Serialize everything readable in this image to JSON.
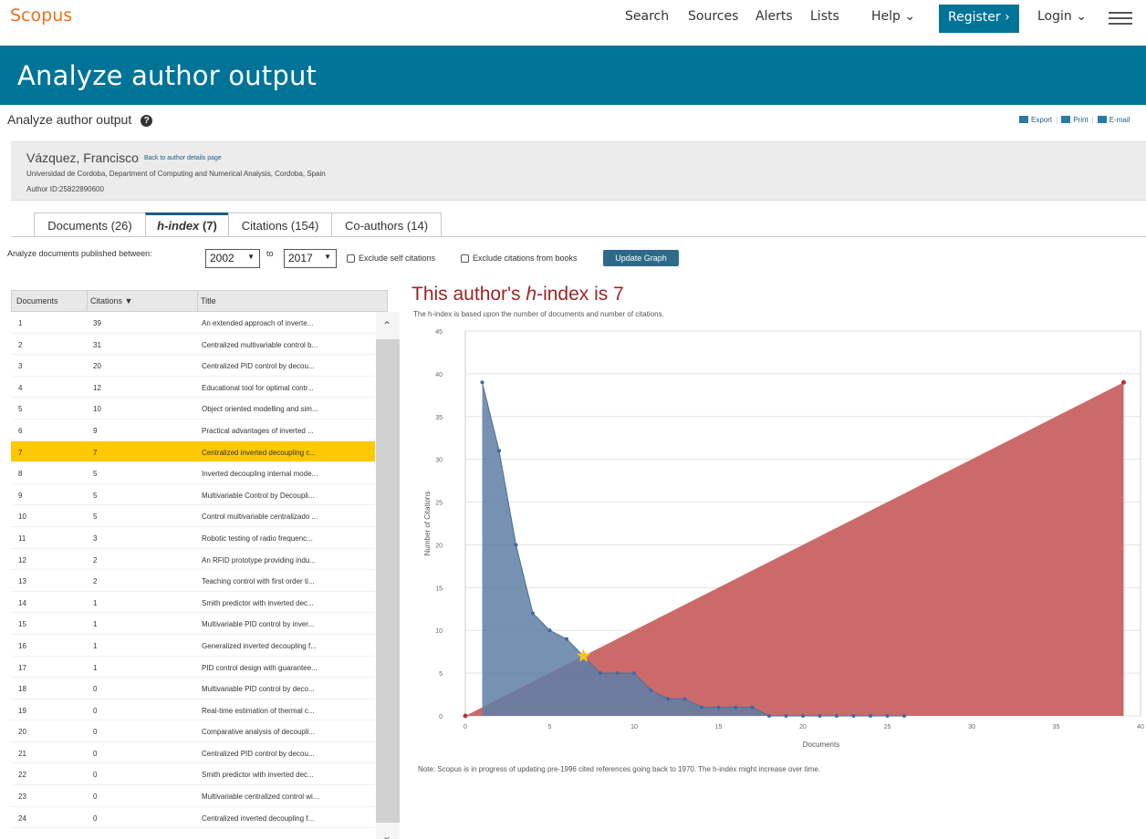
{
  "header": {
    "logo": "Scopus",
    "nav": [
      "Search",
      "Sources",
      "Alerts",
      "Lists"
    ],
    "help": "Help ⌄",
    "register": "Register ›",
    "login": "Login ⌄"
  },
  "banner": {
    "title": "Analyze author output"
  },
  "subheader": {
    "title": "Analyze author output",
    "export": "Export",
    "print": "Print",
    "email": "E-mail"
  },
  "author": {
    "name": "Vázquez, Francisco",
    "back_link": "Back to author details page",
    "affiliation": "Universidad de Cordoba, Department of Computing and Numerical Analysis, Cordoba, Spain",
    "author_id": "Author ID:25822890600"
  },
  "tabs": [
    {
      "prefix": "Documents",
      "value": "(26)"
    },
    {
      "prefix": "h-index",
      "value": "(7)"
    },
    {
      "prefix": "Citations",
      "value": "(154)"
    },
    {
      "prefix": "Co-authors",
      "value": "(14)"
    }
  ],
  "filter": {
    "label": "Analyze documents published between:",
    "from": "2002",
    "to_label": "to",
    "to": "2017",
    "exclude_self": "Exclude self citations",
    "exclude_books": "Exclude citations from books",
    "update_button": "Update Graph"
  },
  "table": {
    "headers": {
      "documents": "Documents",
      "citations": "Citations",
      "title": "Title"
    },
    "rows": [
      {
        "doc": "1",
        "cit": "39",
        "title": "An extended approach of inverte..."
      },
      {
        "doc": "2",
        "cit": "31",
        "title": "Centralized multivariable control b..."
      },
      {
        "doc": "3",
        "cit": "20",
        "title": "Centralized PID control by decou..."
      },
      {
        "doc": "4",
        "cit": "12",
        "title": "Educational tool for optimal contr..."
      },
      {
        "doc": "5",
        "cit": "10",
        "title": "Object oriented modelling and sim..."
      },
      {
        "doc": "6",
        "cit": "9",
        "title": "Practical advantages of inverted ..."
      },
      {
        "doc": "7",
        "cit": "7",
        "title": "Centralized inverted decoupling c..."
      },
      {
        "doc": "8",
        "cit": "5",
        "title": "Inverted decoupling internal mode..."
      },
      {
        "doc": "9",
        "cit": "5",
        "title": "Multivariable Control by Decoupli..."
      },
      {
        "doc": "10",
        "cit": "5",
        "title": "Control multivariable centralizado ..."
      },
      {
        "doc": "11",
        "cit": "3",
        "title": "Robotic testing of radio frequenc..."
      },
      {
        "doc": "12",
        "cit": "2",
        "title": "An RFID prototype providing indu..."
      },
      {
        "doc": "13",
        "cit": "2",
        "title": "Teaching control with first order ti..."
      },
      {
        "doc": "14",
        "cit": "1",
        "title": "Smith predictor with inverted dec..."
      },
      {
        "doc": "15",
        "cit": "1",
        "title": "Multivariable PID control by inver..."
      },
      {
        "doc": "16",
        "cit": "1",
        "title": "Generalized inverted decoupling f..."
      },
      {
        "doc": "17",
        "cit": "1",
        "title": "PID control design with guarantee..."
      },
      {
        "doc": "18",
        "cit": "0",
        "title": "Multivariable PID control by deco..."
      },
      {
        "doc": "19",
        "cit": "0",
        "title": "Real-time estimation of thermal c..."
      },
      {
        "doc": "20",
        "cit": "0",
        "title": "Comparative analysis of decoupli..."
      },
      {
        "doc": "21",
        "cit": "0",
        "title": "Centralized PID control by decou..."
      },
      {
        "doc": "22",
        "cit": "0",
        "title": "Smith predictor with inverted dec..."
      },
      {
        "doc": "23",
        "cit": "0",
        "title": "Multivariable centralized control wi..."
      },
      {
        "doc": "24",
        "cit": "0",
        "title": "Centralized inverted decoupling f..."
      }
    ],
    "highlighted_doc": "7"
  },
  "hindex": {
    "title_prefix": "This author's ",
    "title_h": "h",
    "title_suffix": "-index is 7",
    "subtitle": "The h-index is based upon the number of documents and number of citations.",
    "note": "Note: Scopus is in progress of updating pre-1996 cited references going back to 1970. The h-index might increase over time."
  },
  "chart_data": {
    "type": "area",
    "xlabel": "Documents",
    "ylabel": "Number of Citations",
    "xlim": [
      0,
      40
    ],
    "ylim": [
      0,
      45
    ],
    "xticks": [
      0,
      5,
      10,
      15,
      20,
      25,
      30,
      35,
      40
    ],
    "yticks": [
      0,
      5,
      10,
      15,
      20,
      25,
      30,
      35,
      40,
      45
    ],
    "grid": true,
    "series": [
      {
        "color": "#5e7ea4",
        "x": [
          1,
          2,
          3,
          4,
          5,
          6,
          7,
          8,
          9,
          10,
          11,
          12,
          13,
          14,
          15,
          16,
          17,
          18,
          19,
          20,
          21,
          22,
          23,
          24,
          25,
          26
        ],
        "y": [
          39,
          31,
          20,
          12,
          10,
          9,
          7,
          5,
          5,
          5,
          3,
          2,
          2,
          1,
          1,
          1,
          1,
          0,
          0,
          0,
          0,
          0,
          0,
          0,
          0,
          0
        ]
      },
      {
        "color": "#c75a5a",
        "x": [
          0,
          39
        ],
        "y": [
          0,
          39
        ]
      }
    ],
    "h_index_point": {
      "x": 7,
      "y": 7,
      "color": "#f5c518"
    }
  }
}
